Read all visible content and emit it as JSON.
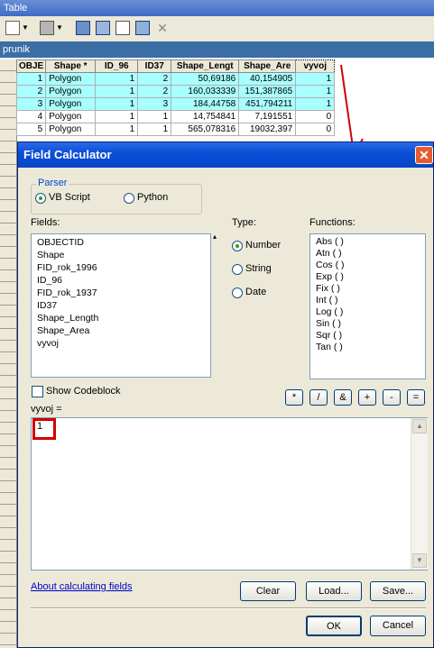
{
  "window": {
    "title": "Table"
  },
  "layer": {
    "name": "prunik"
  },
  "table": {
    "headers": [
      "OBJE",
      "Shape *",
      "ID_96",
      "ID37",
      "Shape_Lengt",
      "Shape_Are",
      "vyvoj"
    ],
    "rows": [
      {
        "cells": [
          "1",
          "Polygon",
          "1",
          "2",
          "50,69186",
          "40,154905",
          "1"
        ],
        "selected": true
      },
      {
        "cells": [
          "2",
          "Polygon",
          "1",
          "2",
          "160,033339",
          "151,387865",
          "1"
        ],
        "selected": true
      },
      {
        "cells": [
          "3",
          "Polygon",
          "1",
          "3",
          "184,44758",
          "451,794211",
          "1"
        ],
        "selected": true
      },
      {
        "cells": [
          "4",
          "Polygon",
          "1",
          "1",
          "14,754841",
          "7,191551",
          "0"
        ],
        "selected": false
      },
      {
        "cells": [
          "5",
          "Polygon",
          "1",
          "1",
          "565,078316",
          "19032,397",
          "0"
        ],
        "selected": false
      }
    ]
  },
  "dialog": {
    "title": "Field Calculator",
    "close_glyph": "✕",
    "parser": {
      "label": "Parser",
      "options": [
        "VB Script",
        "Python"
      ],
      "selected": "VB Script"
    },
    "fields_label": "Fields:",
    "fields": [
      "OBJECTID",
      "Shape",
      "FID_rok_1996",
      "ID_96",
      "FID_rok_1937",
      "ID37",
      "Shape_Length",
      "Shape_Area",
      "vyvoj"
    ],
    "type_label": "Type:",
    "types": [
      "Number",
      "String",
      "Date"
    ],
    "selected_type": "Number",
    "functions_label": "Functions:",
    "functions": [
      "Abs ( )",
      "Atn ( )",
      "Cos ( )",
      "Exp ( )",
      "Fix ( )",
      "Int ( )",
      "Log ( )",
      "Sin ( )",
      "Sqr ( )",
      "Tan ( )"
    ],
    "show_codeblock_label": "Show Codeblock",
    "operators": [
      "*",
      "/",
      "&",
      "+",
      "-",
      "="
    ],
    "expression_label": "vyvoj =",
    "expression_value": "1",
    "about_link": "About calculating fields",
    "buttons": {
      "clear": "Clear",
      "load": "Load...",
      "save": "Save...",
      "ok": "OK",
      "cancel": "Cancel"
    }
  },
  "colors": {
    "selected_row": "#a8ffff",
    "highlight": "#d00000",
    "title_bar": "#0b4fd8"
  }
}
